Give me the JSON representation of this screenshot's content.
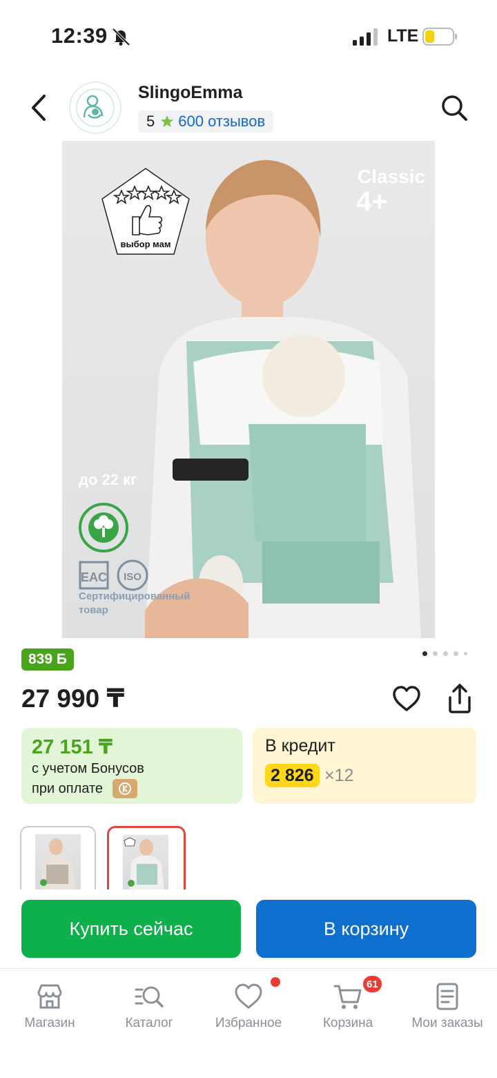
{
  "status_bar": {
    "time": "12:39",
    "network": "LTE"
  },
  "header": {
    "store_name": "SlingoEmma",
    "rating": "5",
    "reviews": "600 отзывов"
  },
  "product_image": {
    "badge_caption": "выбор мам",
    "model_line": "Classic",
    "model_age": "4+",
    "weight": "до 22 кг",
    "certification": "Сертифицированный товар"
  },
  "bonus_badge": "839 Б",
  "gallery": {
    "pages": 5,
    "current_page": 1
  },
  "price": "27 990 ₸",
  "bonus_card": {
    "price": "27 151 ₸",
    "note_line1": "с учетом Бонусов",
    "note_line2": "при оплате"
  },
  "credit_card": {
    "title": "В кредит",
    "monthly": "2 826",
    "term": "×12"
  },
  "actions": {
    "buy_now": "Купить сейчас",
    "add_to_cart": "В корзину"
  },
  "bottom_nav": {
    "shop": "Магазин",
    "catalog": "Каталог",
    "favorites": "Избранное",
    "cart": "Корзина",
    "cart_count": "61",
    "orders": "Мои заказы"
  },
  "colors": {
    "green": "#0db04b",
    "blue": "#0e6fcf",
    "bonus_green": "#4aa31d",
    "credit_yellow": "#ffd618",
    "badge_red": "#ec3b35"
  }
}
